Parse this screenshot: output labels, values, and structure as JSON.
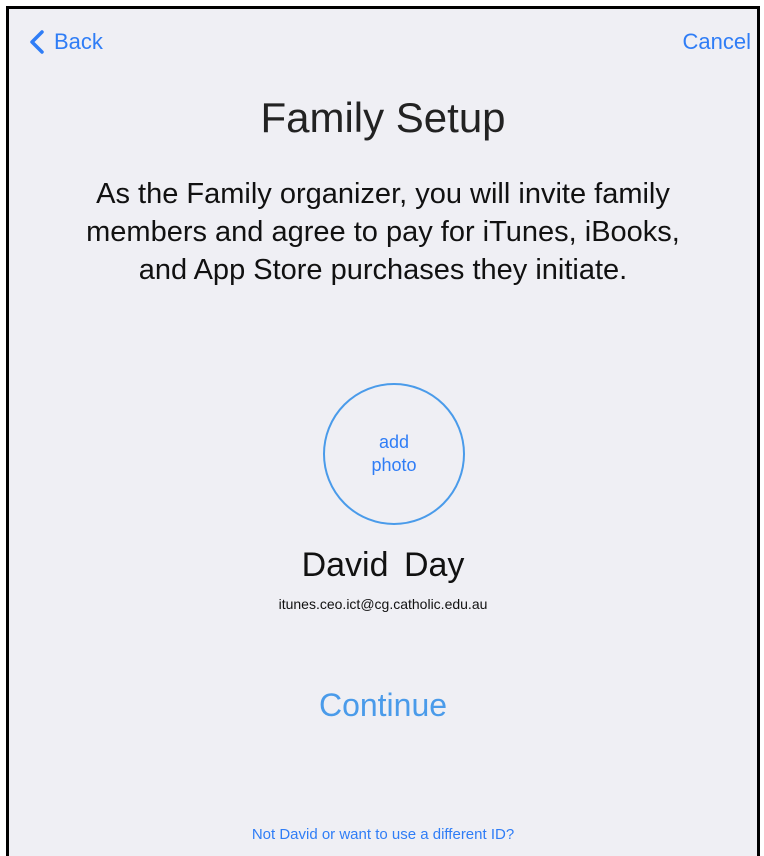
{
  "nav": {
    "back_label": "Back",
    "back_icon": "chevron-left-icon",
    "cancel_label": "Cancel"
  },
  "title": "Family Setup",
  "description": "As the Family organizer, you will invite family members and agree to pay for iTunes, iBooks, and App Store purchases they initiate.",
  "avatar": {
    "label": "add\nphoto"
  },
  "user": {
    "name": "David  Day",
    "email": "itunes.ceo.ict@cg.catholic.edu.au"
  },
  "continue_label": "Continue",
  "different_id_link": "Not David  or want to use a different ID?",
  "colors": {
    "accent": "#2f7df6",
    "background": "#efeff4",
    "circle_border": "#4a9bea"
  }
}
